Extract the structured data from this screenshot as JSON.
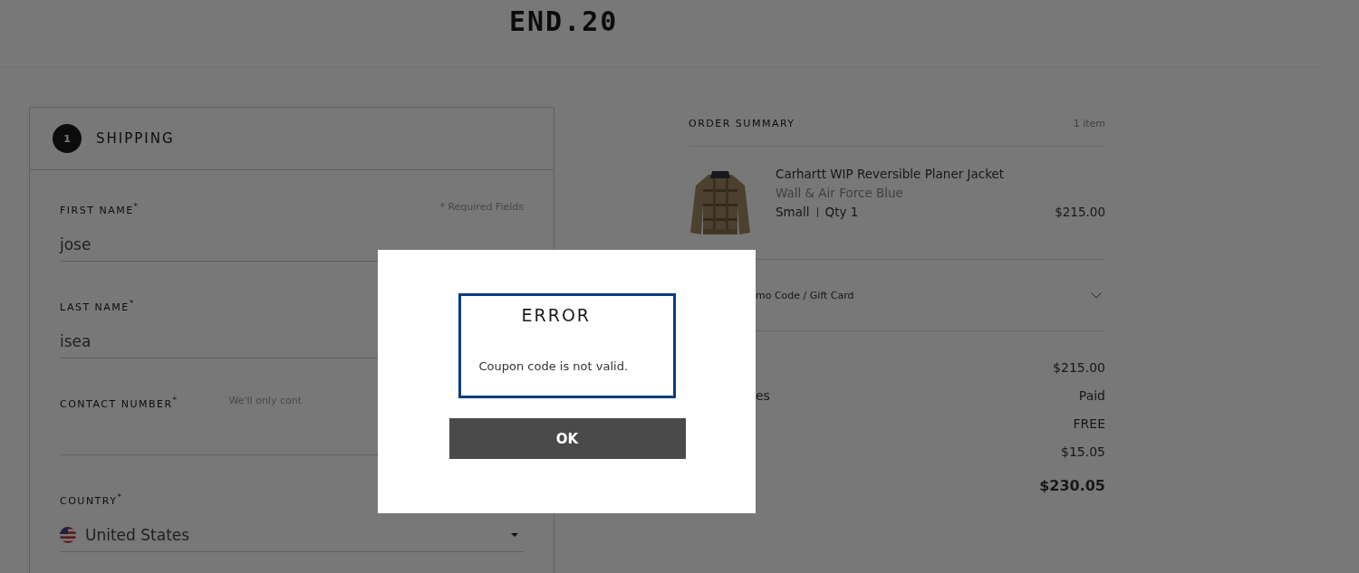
{
  "logo": "END.20",
  "shipping": {
    "step": "1",
    "title": "SHIPPING",
    "required_note": "* Required Fields",
    "fields": [
      {
        "kind": "text",
        "label": "FIRST NAME$^{*}$",
        "value": "jose"
      },
      {
        "kind": "text",
        "label": "LAST NAME$^{*}$",
        "value": "isea"
      },
      {
        "kind": "text",
        "label": "CONTACT NUMBER$^{*}$",
        "hint": "We'll only cont"
      },
      {
        "kind": "select",
        "label": "COUNTRY$^{*}$",
        "value": "United States"
      }
    ]
  },
  "summary": {
    "title": "ORDER SUMMARY",
    "count": "1 item",
    "item": {
      "name": "Carhartt WIP Reversible Planer Jacket",
      "variant": "Wall & Air Force Blue",
      "size": "Small",
      "qty": "Qty 1",
      "price": "$215.00"
    },
    "promo": {
      "label": "mo Code / Gift Card",
      "expanded": false
    },
    "totals": [
      {
        "kind": "line",
        "value": "$215.00"
      },
      {
        "kind": "line",
        "label": "es",
        "value": "Paid"
      },
      {
        "kind": "line",
        "value": "FREE"
      },
      {
        "kind": "line",
        "value": "$15.05"
      },
      {
        "kind": "total",
        "value": "$230.05"
      }
    ]
  },
  "dialog": {
    "title": "ERROR",
    "message": "Coupon code is not valid.",
    "button": "OK"
  }
}
